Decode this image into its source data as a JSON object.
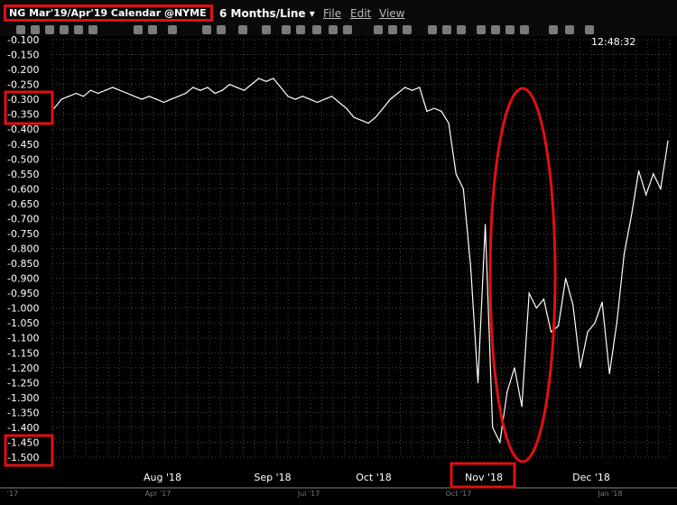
{
  "header": {
    "symbol_label": "NG Mar'19/Apr'19 Calendar @NYME",
    "period_label": "6 Months/Line",
    "menu_file": "File",
    "menu_edit": "Edit",
    "menu_view": "View",
    "clock": "12:48:32"
  },
  "colors": {
    "background": "#000000",
    "line": "#ffffff",
    "grid": "#555555",
    "highlight": "#e01010"
  },
  "chart_data": {
    "type": "line",
    "title": "NG Mar'19/Apr'19 Calendar",
    "xlabel": "",
    "ylabel": "",
    "ylim": [
      -1.5,
      -0.1
    ],
    "yticks": [
      "-0.100",
      "-0.150",
      "-0.200",
      "-0.250",
      "-0.300",
      "-0.350",
      "-0.400",
      "-0.450",
      "-0.500",
      "-0.550",
      "-0.600",
      "-0.650",
      "-0.700",
      "-0.750",
      "-0.800",
      "-0.850",
      "-0.900",
      "-0.950",
      "-1.000",
      "-1.050",
      "-1.100",
      "-1.150",
      "-1.200",
      "-1.250",
      "-1.300",
      "-1.350",
      "-1.400",
      "-1.450",
      "-1.500"
    ],
    "xticks": [
      "Aug '18",
      "Sep '18",
      "Oct '18",
      "Nov '18",
      "Dec '18"
    ],
    "xticks_secondary": [
      "'17",
      "Apr '17",
      "Jul '17",
      "Oct '17",
      "Jan '18"
    ],
    "grid": true,
    "series": [
      {
        "values": [
          -0.33,
          -0.3,
          -0.29,
          -0.28,
          -0.29,
          -0.27,
          -0.28,
          -0.27,
          -0.26,
          -0.27,
          -0.28,
          -0.29,
          -0.3,
          -0.29,
          -0.3,
          -0.31,
          -0.3,
          -0.29,
          -0.28,
          -0.26,
          -0.27,
          -0.26,
          -0.28,
          -0.27,
          -0.25,
          -0.26,
          -0.27,
          -0.25,
          -0.23,
          -0.24,
          -0.23,
          -0.26,
          -0.29,
          -0.3,
          -0.29,
          -0.3,
          -0.31,
          -0.3,
          -0.29,
          -0.31,
          -0.33,
          -0.36,
          -0.37,
          -0.38,
          -0.36,
          -0.33,
          -0.3,
          -0.28,
          -0.26,
          -0.27,
          -0.26,
          -0.34,
          -0.33,
          -0.34,
          -0.38,
          -0.55,
          -0.6,
          -0.86,
          -1.25,
          -0.72,
          -1.4,
          -1.45,
          -1.28,
          -1.2,
          -1.33,
          -0.95,
          -1.0,
          -0.97,
          -1.08,
          -1.06,
          -0.9,
          -0.99,
          -1.2,
          -1.08,
          -1.05,
          -0.98,
          -1.22,
          -1.05,
          -0.82,
          -0.69,
          -0.54,
          -0.62,
          -0.55,
          -0.6,
          -0.44
        ]
      }
    ]
  }
}
